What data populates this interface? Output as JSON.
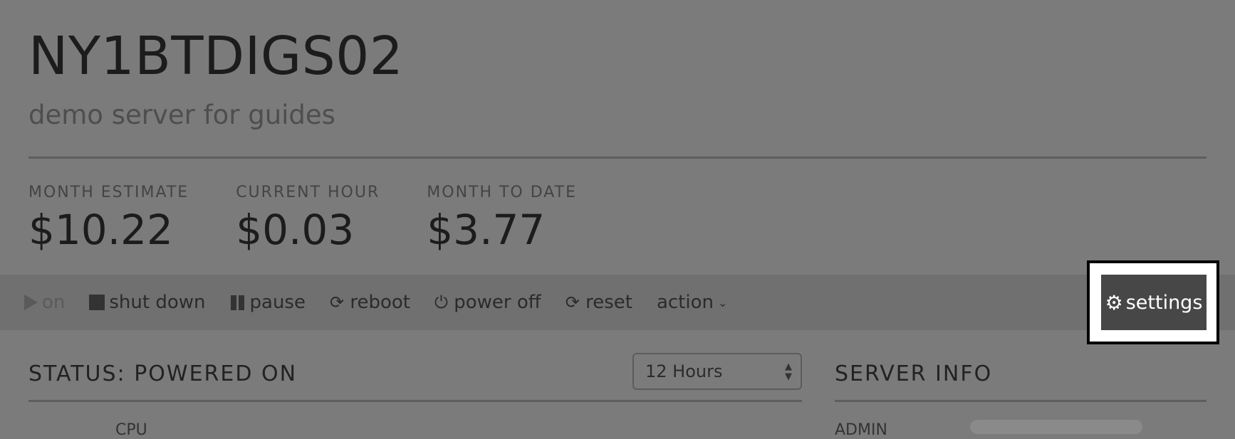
{
  "server": {
    "name": "NY1BTDIGS02",
    "description": "demo server for guides"
  },
  "stats": [
    {
      "label": "MONTH ESTIMATE",
      "value": "$10.22"
    },
    {
      "label": "CURRENT HOUR",
      "value": "$0.03"
    },
    {
      "label": "MONTH TO DATE",
      "value": "$3.77"
    }
  ],
  "toolbar": {
    "on": "on",
    "shut_down": "shut down",
    "pause": "pause",
    "reboot": "reboot",
    "power_off": "power off",
    "reset": "reset",
    "action": "action",
    "settings": "settings"
  },
  "status": {
    "title": "STATUS: POWERED ON",
    "range_selected": "12 Hours"
  },
  "server_info": {
    "title": "SERVER INFO"
  },
  "peek": {
    "cpu": "CPU",
    "admin": "ADMIN"
  }
}
